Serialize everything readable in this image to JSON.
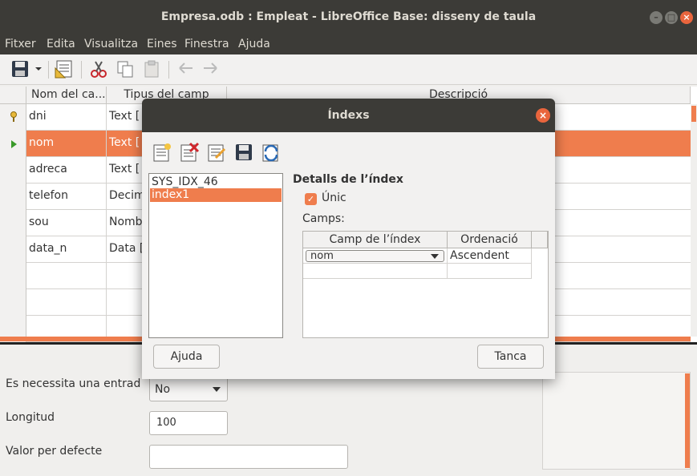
{
  "window": {
    "title": "Empresa.odb : Empleat - LibreOffice Base: disseny de taula",
    "buttons": [
      "minimize",
      "maximize",
      "close"
    ]
  },
  "menu": [
    "Fitxer",
    "Edita",
    "Visualitza",
    "Eines",
    "Finestra",
    "Ajuda"
  ],
  "toolbar": {
    "icons": [
      "save-icon",
      "dropdown-arrow-icon",
      "index-design-icon",
      "cut-icon",
      "copy-icon",
      "paste-icon",
      "undo-icon",
      "redo-icon"
    ]
  },
  "grid": {
    "headers": [
      "Nom del ca...",
      "Tipus del camp",
      "Descripció"
    ],
    "rows": [
      {
        "name": "dni",
        "type": "Text [",
        "marker": "key-icon"
      },
      {
        "name": "nom",
        "type": "Text [",
        "marker": "current-row-arrow-icon",
        "selected": true
      },
      {
        "name": "adreca",
        "type": "Text ["
      },
      {
        "name": "telefon",
        "type": "Decim"
      },
      {
        "name": "sou",
        "type": "Nomb"
      },
      {
        "name": "data_n",
        "type": "Data ["
      }
    ]
  },
  "properties": {
    "required_label": "Es necessita una entrad",
    "required_value": "No",
    "length_label": "Longitud",
    "length_value": "100",
    "default_label": "Valor per defecte",
    "default_value": ""
  },
  "dialog": {
    "title": "Índexs",
    "toolbar_icons": [
      "new-index-icon",
      "delete-index-icon",
      "rename-index-icon",
      "save-index-icon",
      "reset-index-icon"
    ],
    "indexes": [
      "SYS_IDX_46",
      "index1"
    ],
    "selected_index": "index1",
    "details_title": "Detalls de l’índex",
    "unique_label": "Únic",
    "unique_checked": true,
    "fields_label": "Camps:",
    "fields_headers": [
      "Camp de l’índex",
      "Ordenació"
    ],
    "fields_rows": [
      {
        "field": "nom",
        "order": "Ascendent"
      }
    ],
    "help_button": "Ajuda",
    "cancel_button": "Tanca"
  },
  "colors": {
    "accent": "#ef7d4d",
    "titlebar": "#3c3b37"
  }
}
